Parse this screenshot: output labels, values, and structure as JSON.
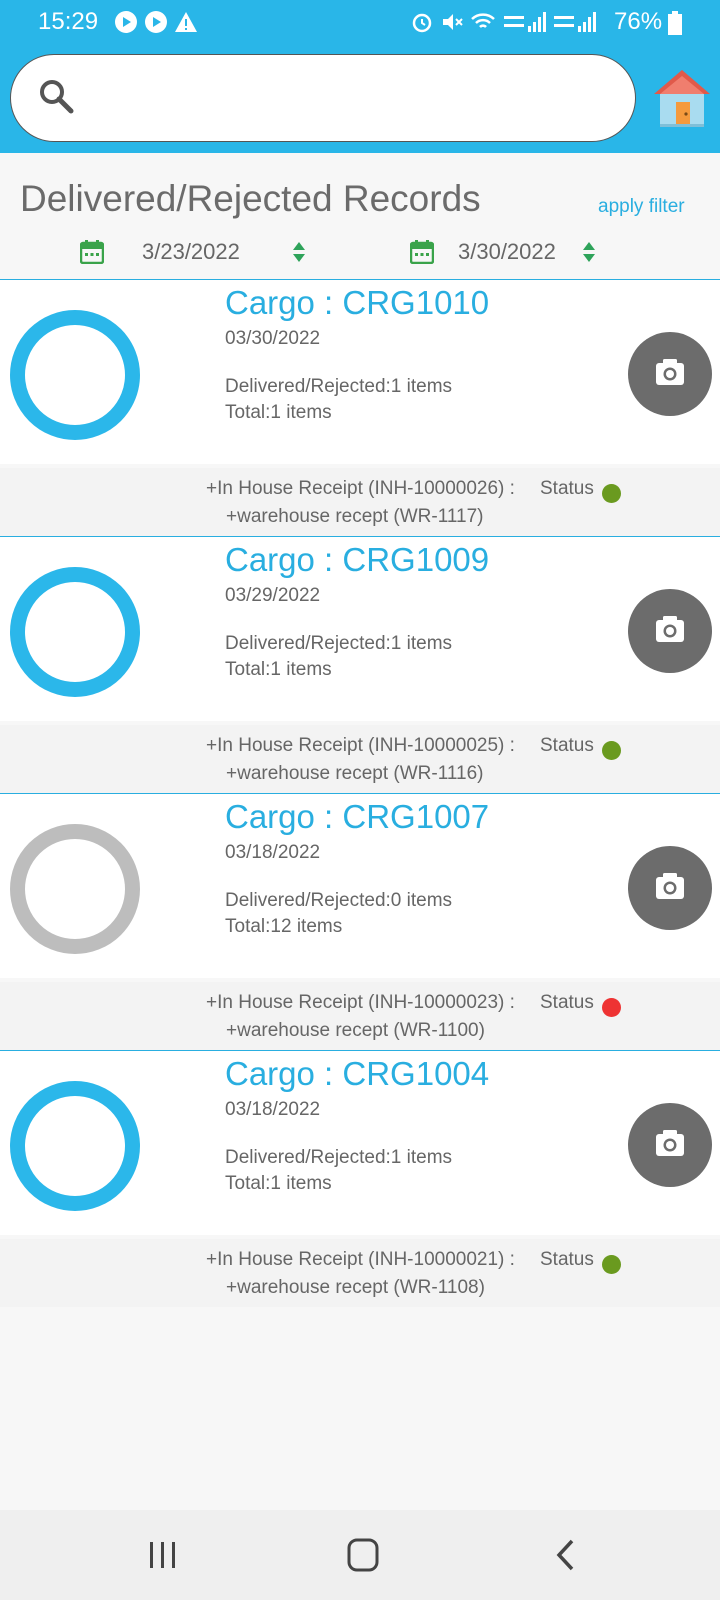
{
  "status_bar": {
    "time": "15:29",
    "battery": "76%"
  },
  "search": {
    "placeholder": "",
    "value": ""
  },
  "page": {
    "title": "Delivered/Rejected Records",
    "apply_filter": "apply filter"
  },
  "filter": {
    "from_date": "3/23/2022",
    "to_date": "3/30/2022"
  },
  "records": [
    {
      "cargo": "Cargo : CRG1010",
      "date": "03/30/2022",
      "delivered": "Delivered/Rejected:1 items",
      "total": "Total:1 items",
      "receipt": "+In House Receipt (INH-10000026) :",
      "warehouse": "+warehouse recept (WR-1117)",
      "status_label": "Status",
      "status_color": "#6a9a1f",
      "ring_color": "#2bb7ea"
    },
    {
      "cargo": "Cargo : CRG1009",
      "date": "03/29/2022",
      "delivered": "Delivered/Rejected:1 items",
      "total": "Total:1 items",
      "receipt": "+In House Receipt (INH-10000025) :",
      "warehouse": "+warehouse recept (WR-1116)",
      "status_label": "Status",
      "status_color": "#6a9a1f",
      "ring_color": "#2bb7ea"
    },
    {
      "cargo": "Cargo : CRG1007",
      "date": "03/18/2022",
      "delivered": "Delivered/Rejected:0 items",
      "total": "Total:12 items",
      "receipt": "+In House Receipt (INH-10000023) :",
      "warehouse": "+warehouse recept (WR-1100)",
      "status_label": "Status",
      "status_color": "#ee3333",
      "ring_color": "#bdbdbd"
    },
    {
      "cargo": "Cargo : CRG1004",
      "date": "03/18/2022",
      "delivered": "Delivered/Rejected:1 items",
      "total": "Total:1 items",
      "receipt": "+In House Receipt (INH-10000021) :",
      "warehouse": "+warehouse recept (WR-1108)",
      "status_label": "Status",
      "status_color": "#6a9a1f",
      "ring_color": "#2bb7ea"
    }
  ],
  "colors": {
    "accent": "#29b6e8",
    "calendar_green": "#3aa34a"
  }
}
